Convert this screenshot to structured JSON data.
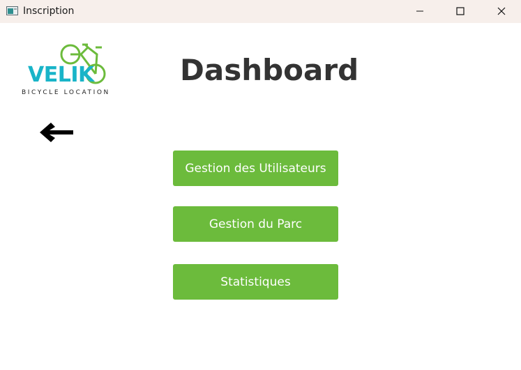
{
  "window": {
    "title": "Inscription",
    "icon": "app-window-icon",
    "controls": {
      "minimize_icon": "minimize-icon",
      "maximize_icon": "maximize-icon",
      "close_icon": "close-icon"
    }
  },
  "logo": {
    "word": "VELIK",
    "subtitle": "BICYCLE LOCATION",
    "icon": "bicycle-icon",
    "colors": {
      "primary": "#19b4c8",
      "bike": "#6cbb3c"
    }
  },
  "navigation": {
    "back_icon": "arrow-left-icon"
  },
  "main": {
    "title": "Dashboard",
    "buttons": [
      {
        "label": "Gestion des Utilisateurs"
      },
      {
        "label": "Gestion du Parc"
      },
      {
        "label": "Statistiques"
      }
    ],
    "button_color": "#6cbb3c"
  }
}
